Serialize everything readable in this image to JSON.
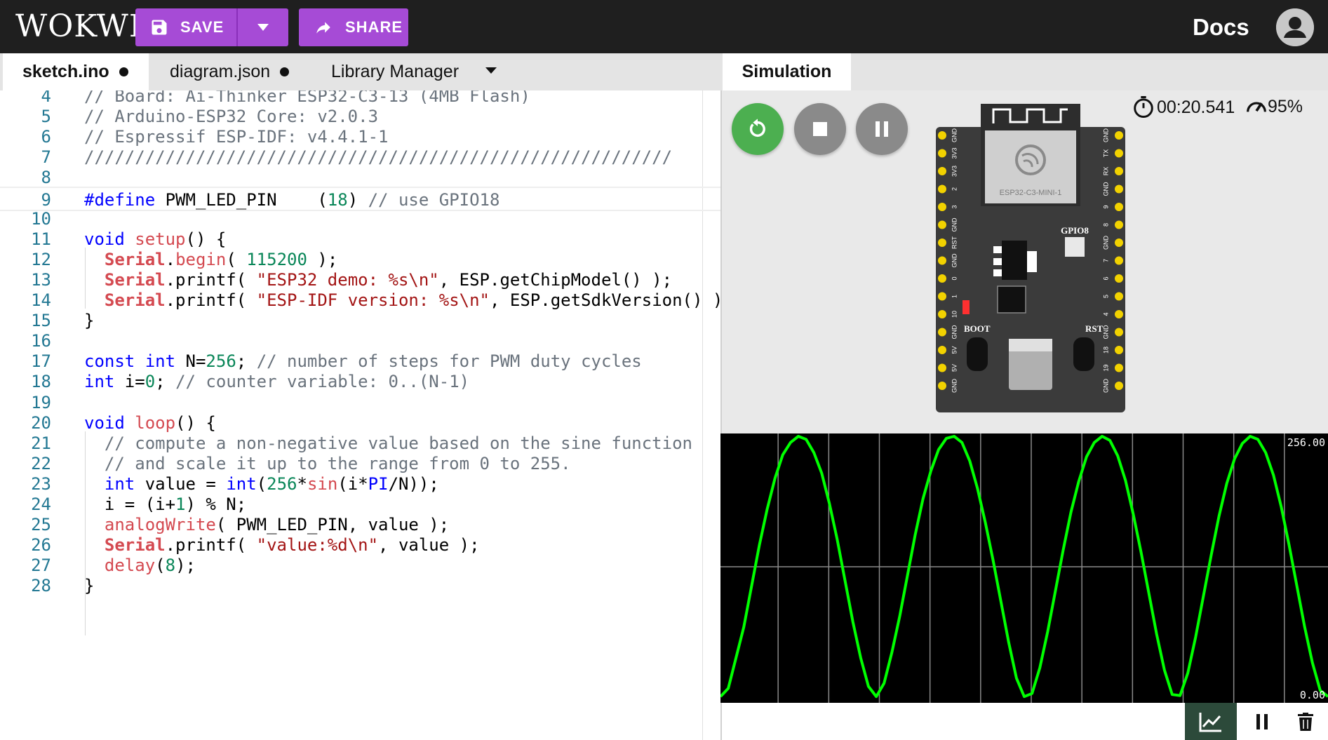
{
  "header": {
    "logo": "WOKWI",
    "save_label": "SAVE",
    "share_label": "SHARE",
    "docs_label": "Docs"
  },
  "tabs": [
    {
      "label": "sketch.ino",
      "active": true,
      "modified": true
    },
    {
      "label": "diagram.json",
      "active": false,
      "modified": true
    },
    {
      "label": "Library Manager",
      "active": false,
      "modified": false
    }
  ],
  "editor": {
    "lines": [
      {
        "n": "4",
        "tokens": [
          [
            "c-com",
            "// Board: Ai-Thinker ESP32-C3-13 (4MB Flash)"
          ]
        ]
      },
      {
        "n": "5",
        "tokens": [
          [
            "c-com",
            "// Arduino-ESP32 Core: v2.0.3"
          ]
        ]
      },
      {
        "n": "6",
        "tokens": [
          [
            "c-com",
            "// Espressif ESP-IDF: v4.4.1-1"
          ]
        ]
      },
      {
        "n": "7",
        "tokens": [
          [
            "c-com",
            "//////////////////////////////////////////////////////////"
          ]
        ]
      },
      {
        "n": "8",
        "tokens": []
      },
      {
        "n": "9",
        "tokens": [
          [
            "c-mac",
            "#define"
          ],
          [
            "c-id",
            " PWM_LED_PIN    ("
          ],
          [
            "c-num",
            "18"
          ],
          [
            "c-id",
            ") "
          ],
          [
            "c-com",
            "// use GPIO18"
          ]
        ]
      },
      {
        "n": "10",
        "tokens": []
      },
      {
        "n": "11",
        "tokens": [
          [
            "c-kw",
            "void"
          ],
          [
            "c-id",
            " "
          ],
          [
            "c-fn",
            "setup"
          ],
          [
            "c-id",
            "() {"
          ]
        ]
      },
      {
        "n": "12",
        "tokens": [
          [
            "c-id",
            "  "
          ],
          [
            "c-cls",
            "Serial"
          ],
          [
            "c-id",
            "."
          ],
          [
            "c-fn",
            "begin"
          ],
          [
            "c-id",
            "( "
          ],
          [
            "c-num",
            "115200"
          ],
          [
            "c-id",
            " );"
          ]
        ]
      },
      {
        "n": "13",
        "tokens": [
          [
            "c-id",
            "  "
          ],
          [
            "c-cls",
            "Serial"
          ],
          [
            "c-id",
            ".printf( "
          ],
          [
            "c-str",
            "\"ESP32 demo: %s\\n\""
          ],
          [
            "c-id",
            ", ESP.getChipModel() );"
          ]
        ]
      },
      {
        "n": "14",
        "tokens": [
          [
            "c-id",
            "  "
          ],
          [
            "c-cls",
            "Serial"
          ],
          [
            "c-id",
            ".printf( "
          ],
          [
            "c-str",
            "\"ESP-IDF version: %s\\n\""
          ],
          [
            "c-id",
            ", ESP.getSdkVersion() );"
          ]
        ]
      },
      {
        "n": "15",
        "tokens": [
          [
            "c-id",
            "}"
          ]
        ]
      },
      {
        "n": "16",
        "tokens": []
      },
      {
        "n": "17",
        "tokens": [
          [
            "c-kw",
            "const"
          ],
          [
            "c-id",
            " "
          ],
          [
            "c-kw",
            "int"
          ],
          [
            "c-id",
            " N="
          ],
          [
            "c-num",
            "256"
          ],
          [
            "c-id",
            "; "
          ],
          [
            "c-com",
            "// number of steps for PWM duty cycles"
          ]
        ]
      },
      {
        "n": "18",
        "tokens": [
          [
            "c-kw",
            "int"
          ],
          [
            "c-id",
            " i="
          ],
          [
            "c-num",
            "0"
          ],
          [
            "c-id",
            "; "
          ],
          [
            "c-com",
            "// counter variable: 0..(N-1)"
          ]
        ]
      },
      {
        "n": "19",
        "tokens": []
      },
      {
        "n": "20",
        "tokens": [
          [
            "c-kw",
            "void"
          ],
          [
            "c-id",
            " "
          ],
          [
            "c-fn",
            "loop"
          ],
          [
            "c-id",
            "() {"
          ]
        ]
      },
      {
        "n": "21",
        "tokens": [
          [
            "c-id",
            "  "
          ],
          [
            "c-com",
            "// compute a non-negative value based on the sine function"
          ]
        ]
      },
      {
        "n": "22",
        "tokens": [
          [
            "c-id",
            "  "
          ],
          [
            "c-com",
            "// and scale it up to the range from 0 to 255."
          ]
        ]
      },
      {
        "n": "23",
        "tokens": [
          [
            "c-id",
            "  "
          ],
          [
            "c-kw",
            "int"
          ],
          [
            "c-id",
            " value = "
          ],
          [
            "c-kw",
            "int"
          ],
          [
            "c-id",
            "("
          ],
          [
            "c-num",
            "256"
          ],
          [
            "c-id",
            "*"
          ],
          [
            "c-fn",
            "sin"
          ],
          [
            "c-id",
            "(i*"
          ],
          [
            "c-kw",
            "PI"
          ],
          [
            "c-id",
            "/N));"
          ]
        ]
      },
      {
        "n": "24",
        "tokens": [
          [
            "c-id",
            "  i = (i+"
          ],
          [
            "c-num",
            "1"
          ],
          [
            "c-id",
            ") % N;"
          ]
        ]
      },
      {
        "n": "25",
        "tokens": [
          [
            "c-id",
            "  "
          ],
          [
            "c-fn",
            "analogWrite"
          ],
          [
            "c-id",
            "( PWM_LED_PIN, value );"
          ]
        ]
      },
      {
        "n": "26",
        "tokens": [
          [
            "c-id",
            "  "
          ],
          [
            "c-cls",
            "Serial"
          ],
          [
            "c-id",
            ".printf( "
          ],
          [
            "c-str",
            "\"value:%d\\n\""
          ],
          [
            "c-id",
            ", value );"
          ]
        ]
      },
      {
        "n": "27",
        "tokens": [
          [
            "c-id",
            "  "
          ],
          [
            "c-fn",
            "delay"
          ],
          [
            "c-id",
            "("
          ],
          [
            "c-num",
            "8"
          ],
          [
            "c-id",
            ");"
          ]
        ]
      },
      {
        "n": "28",
        "tokens": [
          [
            "c-id",
            "}"
          ]
        ]
      }
    ]
  },
  "simulation": {
    "tab_label": "Simulation",
    "elapsed": "00:20.541",
    "speed": "95%",
    "board": {
      "module_label": "ESP32-C3-MINI-1",
      "gpio_label": "GPIO8",
      "boot_label": "BOOT",
      "rst_label": "RST",
      "left_pins": [
        "GND",
        "3V3",
        "3V3",
        "2",
        "3",
        "GND",
        "RST",
        "GND",
        "0",
        "1",
        "10",
        "GND",
        "5V",
        "5V",
        "GND"
      ],
      "right_pins": [
        "GND",
        "TX",
        "RX",
        "GND",
        "9",
        "8",
        "GND",
        "7",
        "6",
        "5",
        "4",
        "GND",
        "18",
        "19",
        "GND"
      ]
    }
  },
  "plotter": {
    "y_max_label": "256.00",
    "y_min_label": "0.00",
    "colors": {
      "trace": "#00ff00",
      "grid": "#8a8a8a",
      "background": "#000000"
    }
  },
  "chart_data": {
    "type": "line",
    "series": [
      {
        "values": [
          2,
          10,
          40,
          70,
          110,
          150,
          185,
          215,
          238,
          250,
          256,
          253,
          240,
          220,
          190,
          155,
          115,
          75,
          40,
          12,
          2,
          15,
          45,
          80,
          120,
          160,
          195,
          222,
          243,
          254,
          256,
          250,
          232,
          205,
          172,
          135,
          95,
          55,
          20,
          2,
          5,
          30,
          65,
          105,
          145,
          182,
          212,
          236,
          250,
          256,
          252,
          237,
          213,
          180,
          143,
          103,
          63,
          28,
          4,
          3,
          25,
          60,
          100,
          140,
          178,
          210,
          234,
          249,
          256,
          253,
          240,
          218,
          187,
          150,
          110,
          70,
          35,
          8,
          2
        ]
      }
    ],
    "ylim": [
      0,
      256
    ]
  }
}
